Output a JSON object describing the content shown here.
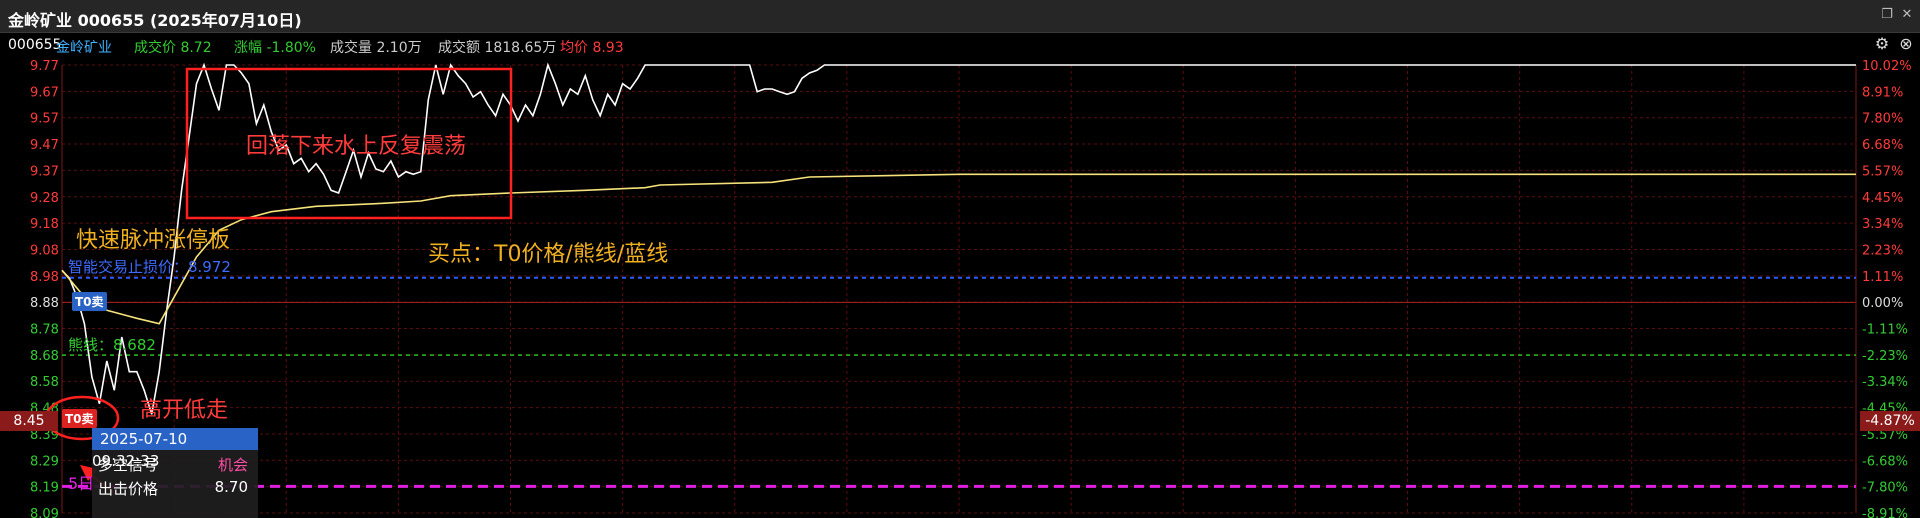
{
  "window": {
    "title": "金岭矿业 000655 (2025年07月10日)"
  },
  "info": {
    "code": "000655",
    "name": "金岭矿业",
    "price_label": "成交价 8.72",
    "change_label": "涨幅 -1.80%",
    "volume_label": "成交量 2.10万",
    "amount_label": "成交额 1818.65万",
    "avg_label": "均价 8.93"
  },
  "colors": {
    "up": "#ff3b3b",
    "down": "#33cc33",
    "price_line": "#ffffff",
    "avg_line": "#f5e27a",
    "grid": "#5a0d0d",
    "blue_line": "#2b5cff",
    "green_line": "#22c222",
    "magenta_line": "#e020e0"
  },
  "icons": {
    "settings": "gear-icon",
    "close": "close-icon",
    "restore": "restore-icon"
  },
  "annotations": {
    "box_label": "回落下来水上反复震荡",
    "pulse_label": "快速脉冲涨停板",
    "buy_label": "买点：T0价格/熊线/蓝线",
    "low_label": "高开低走",
    "stop_label": "智能交易止损价：8.972",
    "bear_label": "熊线：8.682",
    "five_day_label": "5日",
    "t0_sell_1": "T0卖",
    "t0_sell_2": "T0卖"
  },
  "current": {
    "price_tag": "8.45",
    "pct_tag": "-4.87%"
  },
  "tooltip": {
    "time": "2025-07-10 09:32:33",
    "row1_label": "多空信号",
    "row1_value": "机会",
    "row2_label": "出击价格",
    "row2_value": "8.70"
  },
  "chart_data": {
    "type": "line",
    "title": "",
    "y_ticks_left": [
      "9.77",
      "9.67",
      "9.57",
      "9.47",
      "9.37",
      "9.28",
      "9.18",
      "9.08",
      "8.98",
      "8.88",
      "8.78",
      "8.68",
      "8.58",
      "8.48",
      "8.39",
      "8.29",
      "8.19",
      "8.09"
    ],
    "y_ticks_right": [
      "10.02%",
      "8.91%",
      "7.80%",
      "6.68%",
      "5.57%",
      "4.45%",
      "3.34%",
      "2.23%",
      "1.11%",
      "0.00%",
      "-1.11%",
      "-2.23%",
      "-3.34%",
      "-4.45%",
      "-5.57%",
      "-6.68%",
      "-7.80%",
      "-8.91%"
    ],
    "prev_close": 8.88,
    "ylim": [
      8.09,
      9.77
    ],
    "x_session_minutes": 240,
    "series": [
      {
        "name": "price",
        "values": [
          [
            0,
            9.0
          ],
          [
            1,
            8.97
          ],
          [
            2,
            8.9
          ],
          [
            3,
            8.8
          ],
          [
            4,
            8.6
          ],
          [
            5,
            8.5
          ],
          [
            6,
            8.66
          ],
          [
            7,
            8.55
          ],
          [
            8,
            8.75
          ],
          [
            9,
            8.62
          ],
          [
            10,
            8.62
          ],
          [
            11,
            8.55
          ],
          [
            12,
            8.46
          ],
          [
            13,
            8.62
          ],
          [
            14,
            8.85
          ],
          [
            15,
            9.05
          ],
          [
            16,
            9.3
          ],
          [
            17,
            9.5
          ],
          [
            18,
            9.7
          ],
          [
            19,
            9.77
          ],
          [
            20,
            9.68
          ],
          [
            21,
            9.6
          ],
          [
            22,
            9.77
          ],
          [
            23,
            9.77
          ],
          [
            24,
            9.74
          ],
          [
            25,
            9.7
          ],
          [
            26,
            9.55
          ],
          [
            27,
            9.62
          ],
          [
            28,
            9.52
          ],
          [
            29,
            9.45
          ],
          [
            30,
            9.47
          ],
          [
            31,
            9.4
          ],
          [
            32,
            9.42
          ],
          [
            33,
            9.37
          ],
          [
            34,
            9.4
          ],
          [
            35,
            9.36
          ],
          [
            36,
            9.3
          ],
          [
            37,
            9.29
          ],
          [
            38,
            9.37
          ],
          [
            39,
            9.45
          ],
          [
            40,
            9.35
          ],
          [
            41,
            9.44
          ],
          [
            42,
            9.38
          ],
          [
            43,
            9.37
          ],
          [
            44,
            9.41
          ],
          [
            45,
            9.35
          ],
          [
            46,
            9.37
          ],
          [
            47,
            9.36
          ],
          [
            48,
            9.37
          ],
          [
            49,
            9.64
          ],
          [
            50,
            9.77
          ],
          [
            51,
            9.66
          ],
          [
            52,
            9.77
          ],
          [
            53,
            9.73
          ],
          [
            54,
            9.7
          ],
          [
            55,
            9.65
          ],
          [
            56,
            9.67
          ],
          [
            57,
            9.62
          ],
          [
            58,
            9.58
          ],
          [
            59,
            9.66
          ],
          [
            60,
            9.62
          ],
          [
            61,
            9.56
          ],
          [
            62,
            9.62
          ],
          [
            63,
            9.58
          ],
          [
            64,
            9.66
          ],
          [
            65,
            9.77
          ],
          [
            66,
            9.7
          ],
          [
            67,
            9.62
          ],
          [
            68,
            9.68
          ],
          [
            69,
            9.66
          ],
          [
            70,
            9.73
          ],
          [
            71,
            9.64
          ],
          [
            72,
            9.58
          ],
          [
            73,
            9.66
          ],
          [
            74,
            9.62
          ],
          [
            75,
            9.7
          ],
          [
            76,
            9.68
          ],
          [
            77,
            9.72
          ],
          [
            78,
            9.77
          ],
          [
            85,
            9.77
          ],
          [
            92,
            9.77
          ],
          [
            93,
            9.67
          ],
          [
            94,
            9.68
          ],
          [
            95,
            9.68
          ],
          [
            96,
            9.67
          ],
          [
            97,
            9.66
          ],
          [
            98,
            9.67
          ],
          [
            99,
            9.72
          ],
          [
            100,
            9.74
          ],
          [
            101,
            9.75
          ],
          [
            102,
            9.77
          ],
          [
            240,
            9.77
          ]
        ]
      },
      {
        "name": "avg",
        "values": [
          [
            0,
            9.0
          ],
          [
            3,
            8.9
          ],
          [
            6,
            8.85
          ],
          [
            10,
            8.82
          ],
          [
            13,
            8.8
          ],
          [
            16,
            8.95
          ],
          [
            18,
            9.05
          ],
          [
            21,
            9.15
          ],
          [
            24,
            9.19
          ],
          [
            28,
            9.22
          ],
          [
            34,
            9.24
          ],
          [
            42,
            9.25
          ],
          [
            48,
            9.26
          ],
          [
            52,
            9.28
          ],
          [
            60,
            9.29
          ],
          [
            70,
            9.3
          ],
          [
            78,
            9.31
          ],
          [
            80,
            9.32
          ],
          [
            95,
            9.33
          ],
          [
            100,
            9.35
          ],
          [
            120,
            9.36
          ],
          [
            160,
            9.36
          ],
          [
            240,
            9.36
          ]
        ]
      }
    ],
    "reference_lines": [
      {
        "name": "智能交易止损价",
        "value": 8.972
      },
      {
        "name": "熊线",
        "value": 8.682
      },
      {
        "name": "5日",
        "value": 8.19
      }
    ]
  }
}
